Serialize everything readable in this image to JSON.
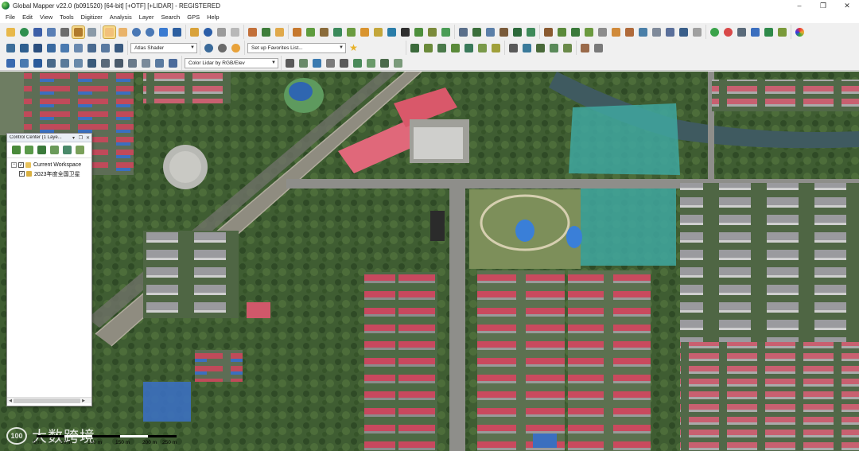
{
  "window": {
    "title": "Global Mapper v22.0 (b091520) [64-bit] [+OTF] [+LIDAR] - REGISTERED",
    "minimize": "–",
    "maximize": "❐",
    "close": "✕"
  },
  "menu": [
    "File",
    "Edit",
    "View",
    "Tools",
    "Digitizer",
    "Analysis",
    "Layer",
    "Search",
    "GPS",
    "Help"
  ],
  "toolbar": {
    "shader_select": "Atlas Shader",
    "favorites_select": "Set up Favorites List...",
    "lidar_color_select": "Color Lidar by RGB/Elev"
  },
  "control_center": {
    "title": "Control Center (1 Laye...",
    "pin": "📌",
    "restore": "❐",
    "close": "✕",
    "layers": [
      {
        "label": "Current Workspace",
        "checked": "✓",
        "expand": "−"
      },
      {
        "label": "2023年度全国卫星",
        "checked": "✓"
      }
    ]
  },
  "scale_bar": {
    "labels": [
      "0 m",
      "50 m",
      "100 m",
      "150 m",
      "200 m",
      "250 m"
    ]
  },
  "watermark": {
    "logo_text": "100",
    "text": "大数跨境"
  },
  "icons": {
    "file_tools": [
      "open-folder-icon",
      "globe-icon",
      "save-icon",
      "print-icon",
      "wrench-icon",
      "layers-icon",
      "grid-icon"
    ],
    "nav_tools": [
      "pan-hand-icon",
      "hand-icon",
      "zoom-in-icon",
      "zoom-out-icon",
      "back-arrow-icon",
      "home-icon"
    ],
    "accent_active": "#f7d98b"
  },
  "colors": {
    "titlebar_bg": "#ffffff",
    "toolbar_bg": "#f0f0f0",
    "map_vegetation": "#4d6b3a",
    "roof_red": "#c94a5a",
    "roof_blue": "#3b6fbf",
    "pond": "#3fa7a0"
  }
}
